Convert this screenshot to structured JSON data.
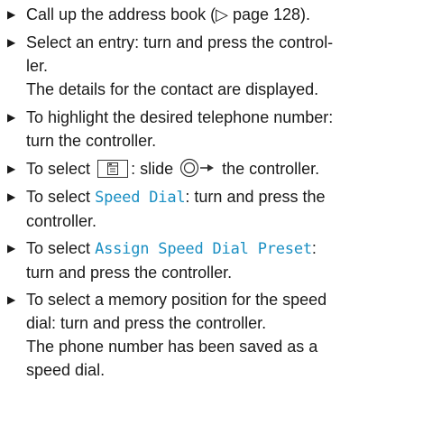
{
  "steps": [
    {
      "lines": [
        "Call up the address book (▷ page 128)."
      ]
    },
    {
      "lines": [
        "Select an entry: turn and press the control-",
        "ler."
      ],
      "note": [
        "The details for the contact are displayed."
      ]
    },
    {
      "lines": [
        "To highlight the desired telephone number:",
        "turn the controller."
      ]
    },
    {
      "pre": "To select",
      "icon": "phone-menu-icon",
      "mid": ": slide",
      "slide_icon": "controller-slide-right-icon",
      "post": "the controller."
    },
    {
      "pre": "To select",
      "term": "Speed Dial",
      "post": ": turn and press the",
      "line2": "controller."
    },
    {
      "pre": "To select",
      "term": "Assign Speed Dial Preset",
      "post": ":",
      "line2": "turn and press the controller."
    },
    {
      "lines": [
        "To select a memory position for the speed",
        "dial: turn and press the controller."
      ],
      "note": [
        "The phone number has been saved as a",
        "speed dial."
      ]
    }
  ],
  "bullet_glyph": "▶",
  "colors": {
    "text": "#1a1a1a",
    "term": "#1a8fc3"
  }
}
